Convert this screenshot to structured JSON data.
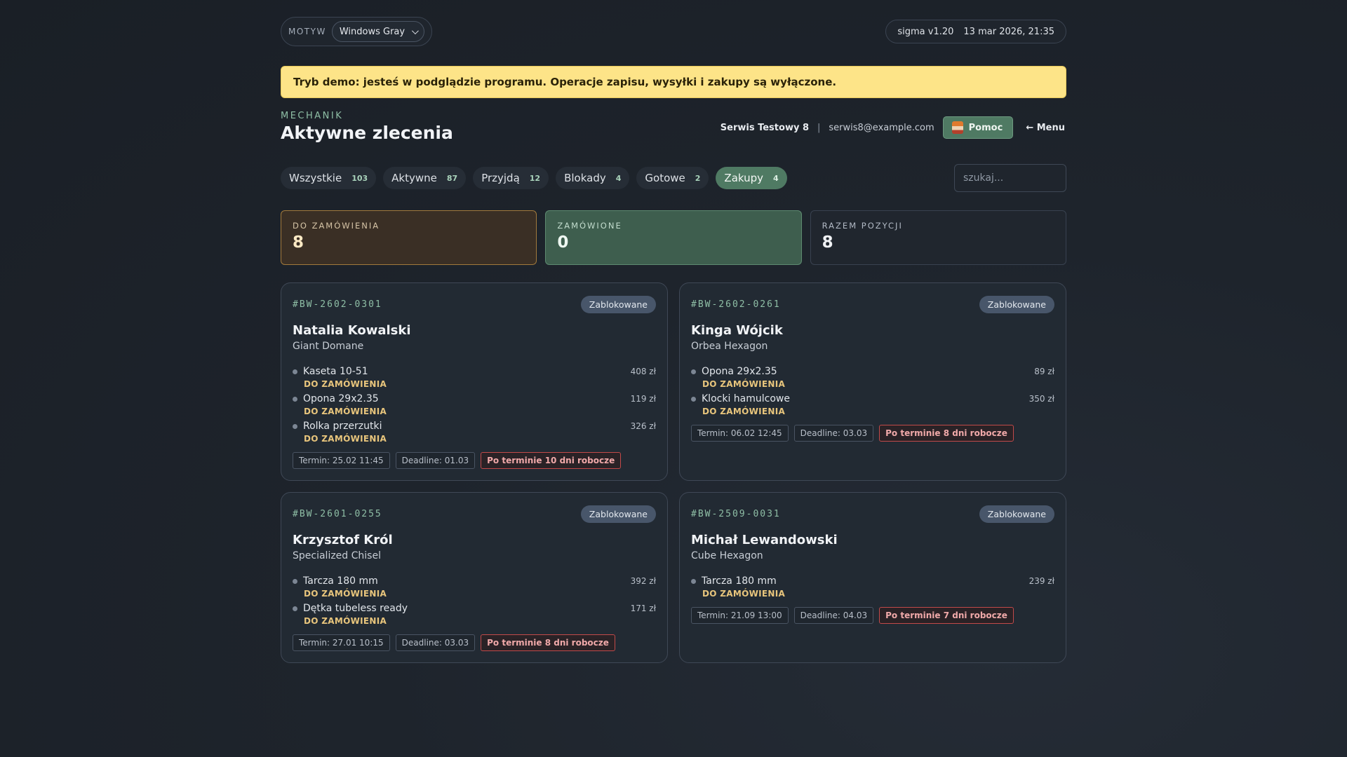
{
  "topbar": {
    "theme_label": "MOTYW",
    "theme_value": "Windows Gray",
    "version": "sigma v1.20",
    "datetime": "13 mar 2026, 21:35"
  },
  "banner": {
    "text": "Tryb demo: jesteś w podglądzie programu. Operacje zapisu, wysyłki i zakupy są wyłączone."
  },
  "header": {
    "role": "MECHANIK",
    "title": "Aktywne zlecenia",
    "user_name": "Serwis Testowy 8",
    "separator": "|",
    "user_email": "serwis8@example.com",
    "help_label": "Pomoc",
    "menu_label": "← Menu"
  },
  "tabs": [
    {
      "label": "Wszystkie",
      "count": "103"
    },
    {
      "label": "Aktywne",
      "count": "87"
    },
    {
      "label": "Przyjdą",
      "count": "12"
    },
    {
      "label": "Blokady",
      "count": "4"
    },
    {
      "label": "Gotowe",
      "count": "2"
    },
    {
      "label": "Zakupy",
      "count": "4"
    }
  ],
  "active_tab": "Zakupy",
  "search": {
    "placeholder": "szukaj..."
  },
  "stats": [
    {
      "label": "DO ZAMÓWIENIA",
      "value": "8"
    },
    {
      "label": "ZAMÓWIONE",
      "value": "0"
    },
    {
      "label": "RAZEM POZYCJI",
      "value": "8"
    }
  ],
  "orders": [
    {
      "id": "#BW-2602-0301",
      "status": "Zablokowane",
      "customer": "Natalia Kowalski",
      "bike": "Giant Domane",
      "items": [
        {
          "name": "Kaseta 10-51",
          "price": "408 zł",
          "status": "DO ZAMÓWIENIA"
        },
        {
          "name": "Opona 29x2.35",
          "price": "119 zł",
          "status": "DO ZAMÓWIENIA"
        },
        {
          "name": "Rolka przerzutki",
          "price": "326 zł",
          "status": "DO ZAMÓWIENIA"
        }
      ],
      "termin": "Termin: 25.02 11:45",
      "deadline": "Deadline: 01.03",
      "overdue": "Po terminie 10 dni robocze"
    },
    {
      "id": "#BW-2602-0261",
      "status": "Zablokowane",
      "customer": "Kinga Wójcik",
      "bike": "Orbea Hexagon",
      "items": [
        {
          "name": "Opona 29x2.35",
          "price": "89 zł",
          "status": "DO ZAMÓWIENIA"
        },
        {
          "name": "Klocki hamulcowe",
          "price": "350 zł",
          "status": "DO ZAMÓWIENIA"
        }
      ],
      "termin": "Termin: 06.02 12:45",
      "deadline": "Deadline: 03.03",
      "overdue": "Po terminie 8 dni robocze"
    },
    {
      "id": "#BW-2601-0255",
      "status": "Zablokowane",
      "customer": "Krzysztof Król",
      "bike": "Specialized Chisel",
      "items": [
        {
          "name": "Tarcza 180 mm",
          "price": "392 zł",
          "status": "DO ZAMÓWIENIA"
        },
        {
          "name": "Dętka tubeless ready",
          "price": "171 zł",
          "status": "DO ZAMÓWIENIA"
        }
      ],
      "termin": "Termin: 27.01 10:15",
      "deadline": "Deadline: 03.03",
      "overdue": "Po terminie 8 dni robocze"
    },
    {
      "id": "#BW-2509-0031",
      "status": "Zablokowane",
      "customer": "Michał Lewandowski",
      "bike": "Cube Hexagon",
      "items": [
        {
          "name": "Tarcza 180 mm",
          "price": "239 zł",
          "status": "DO ZAMÓWIENIA"
        }
      ],
      "termin": "Termin: 21.09 13:00",
      "deadline": "Deadline: 04.03",
      "overdue": "Po terminie 7 dni robocze"
    }
  ],
  "colors": {
    "accent": "#4f7a63",
    "banner_bg": "#fde488",
    "warn_text": "#e8c57c",
    "overdue_border": "#c24a4a"
  }
}
